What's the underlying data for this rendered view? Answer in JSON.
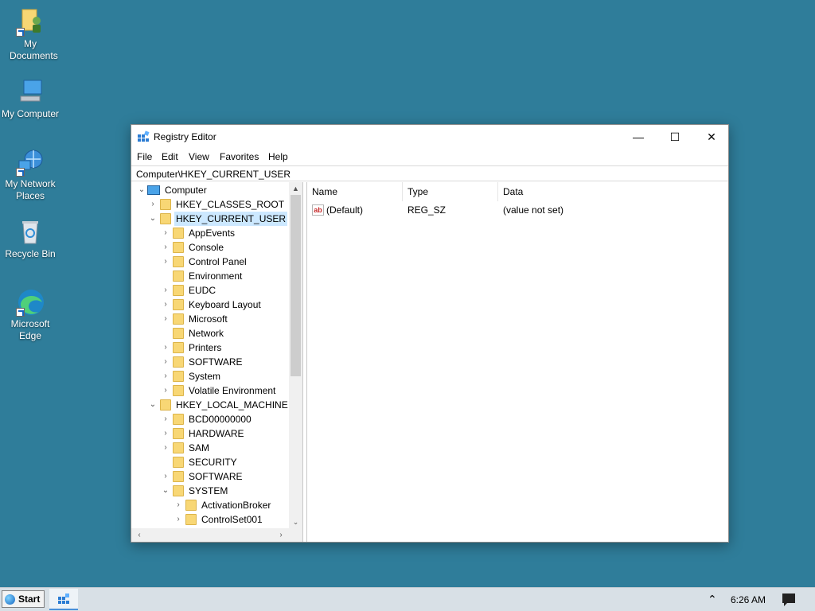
{
  "desktop": {
    "icons": [
      {
        "label": "My Documents"
      },
      {
        "label": "My Computer"
      },
      {
        "label": "My Network Places"
      },
      {
        "label": "Recycle Bin"
      },
      {
        "label": "Microsoft Edge"
      }
    ]
  },
  "window": {
    "title": "Registry Editor",
    "buttons": {
      "minimize": "—",
      "maximize": "☐",
      "close": "✕"
    },
    "menu": [
      "File",
      "Edit",
      "View",
      "Favorites",
      "Help"
    ],
    "address": "Computer\\HKEY_CURRENT_USER"
  },
  "tree": {
    "items": [
      {
        "label": "Computer",
        "expander": "⌄"
      },
      {
        "label": "HKEY_CLASSES_ROOT",
        "expander": "›"
      },
      {
        "label": "HKEY_CURRENT_USER",
        "expander": "⌄"
      },
      {
        "label": "AppEvents",
        "expander": "›"
      },
      {
        "label": "Console",
        "expander": "›"
      },
      {
        "label": "Control Panel",
        "expander": "›"
      },
      {
        "label": "Environment",
        "expander": ""
      },
      {
        "label": "EUDC",
        "expander": "›"
      },
      {
        "label": "Keyboard Layout",
        "expander": "›"
      },
      {
        "label": "Microsoft",
        "expander": "›"
      },
      {
        "label": "Network",
        "expander": ""
      },
      {
        "label": "Printers",
        "expander": "›"
      },
      {
        "label": "SOFTWARE",
        "expander": "›"
      },
      {
        "label": "System",
        "expander": "›"
      },
      {
        "label": "Volatile Environment",
        "expander": "›"
      },
      {
        "label": "HKEY_LOCAL_MACHINE",
        "expander": "⌄"
      },
      {
        "label": "BCD00000000",
        "expander": "›"
      },
      {
        "label": "HARDWARE",
        "expander": "›"
      },
      {
        "label": "SAM",
        "expander": "›"
      },
      {
        "label": "SECURITY",
        "expander": ""
      },
      {
        "label": "SOFTWARE",
        "expander": "›"
      },
      {
        "label": "SYSTEM",
        "expander": "⌄"
      },
      {
        "label": "ActivationBroker",
        "expander": "›"
      },
      {
        "label": "ControlSet001",
        "expander": "›"
      }
    ],
    "scroll": {
      "up": "▲",
      "down": "⌄",
      "left": "‹",
      "right": "›"
    }
  },
  "list": {
    "columns": [
      "Name",
      "Type",
      "Data"
    ],
    "rows": [
      {
        "icon": "ab",
        "name": "(Default)",
        "type": "REG_SZ",
        "data": "(value not set)"
      }
    ]
  },
  "taskbar": {
    "start_label": "Start",
    "tray_chevron": "⌃",
    "clock": "6:26 AM"
  }
}
